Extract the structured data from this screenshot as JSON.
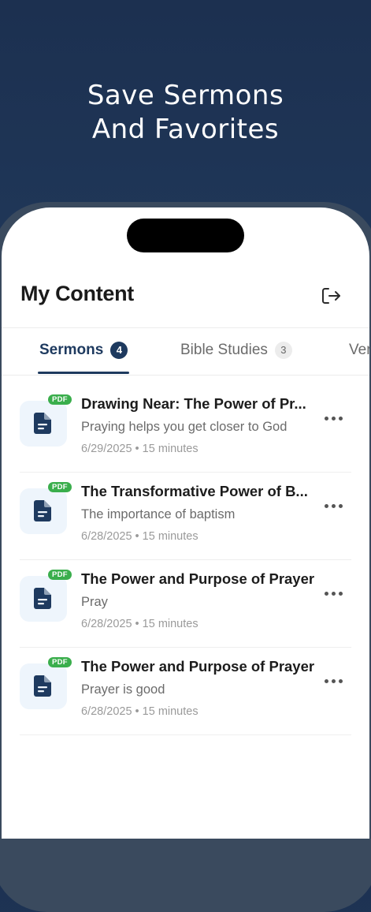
{
  "hero": {
    "line1": "Save Sermons",
    "line2": "And Favorites"
  },
  "screen": {
    "title": "My Content",
    "logout_icon": "logout-icon"
  },
  "tabs": [
    {
      "label": "Sermons",
      "count": "4",
      "active": true
    },
    {
      "label": "Bible Studies",
      "count": "3",
      "active": false
    },
    {
      "label": "Ver",
      "count": "",
      "active": false
    }
  ],
  "items": [
    {
      "badge": "PDF",
      "title": "Drawing Near: The Power of Pr...",
      "description": "Praying helps you get closer to God",
      "date": "6/29/2025",
      "duration": "15 minutes"
    },
    {
      "badge": "PDF",
      "title": "The Transformative Power of B...",
      "description": "The importance of baptism",
      "date": "6/28/2025",
      "duration": "15 minutes"
    },
    {
      "badge": "PDF",
      "title": "The Power and Purpose of Prayer",
      "description": "Pray",
      "date": "6/28/2025",
      "duration": "15 minutes"
    },
    {
      "badge": "PDF",
      "title": "The Power and Purpose of Prayer",
      "description": "Prayer is good",
      "date": "6/28/2025",
      "duration": "15 minutes"
    }
  ],
  "meta_separator": "•",
  "colors": {
    "accent": "#1e3a5f",
    "pdf_badge": "#3aae4c",
    "background": "#213a5c"
  }
}
